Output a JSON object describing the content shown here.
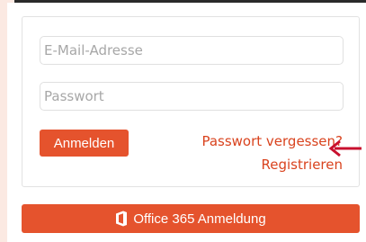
{
  "form": {
    "email_placeholder": "E-Mail-Adresse",
    "password_placeholder": "Passwort",
    "login_label": "Anmelden",
    "forgot_password_label": "Passwort vergessen?",
    "register_label": "Registrieren"
  },
  "office": {
    "label": "Office 365 Anmeldung",
    "icon": "office-logo-icon"
  },
  "colors": {
    "accent": "#e5532d",
    "link": "#d9431e",
    "arrow": "#c8102e",
    "side_strip": "#fbe9e2"
  }
}
